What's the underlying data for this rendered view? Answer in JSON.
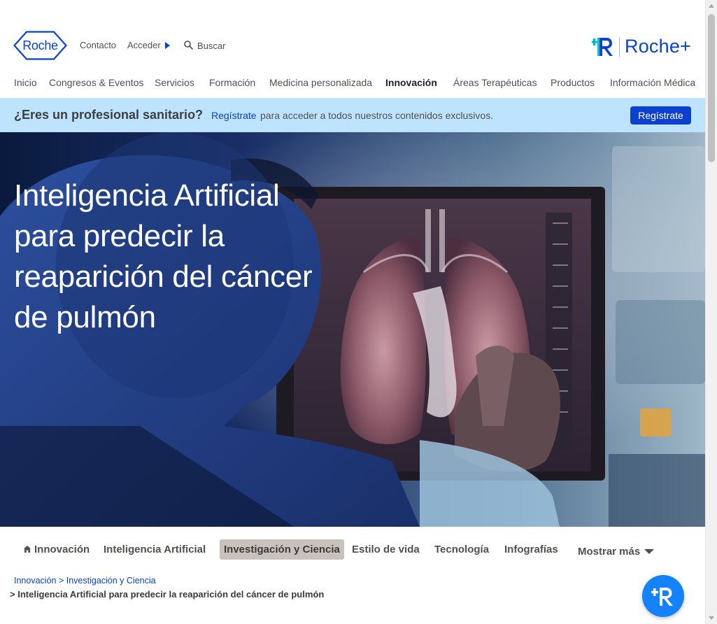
{
  "header": {
    "logo_text": "Roche",
    "top_links": {
      "contacto": "Contacto",
      "acceder": "Acceder",
      "buscar": "Buscar"
    },
    "brand_plus": "Roche+"
  },
  "nav": {
    "items": [
      {
        "label": "Inicio",
        "active": false
      },
      {
        "label": "Congresos & Eventos",
        "active": false
      },
      {
        "label": "Servicios",
        "active": false
      },
      {
        "label": "Formación",
        "active": false
      },
      {
        "label": "Medicina personalizada",
        "active": false
      },
      {
        "label": "Innovación",
        "active": true
      },
      {
        "label": "Áreas Terapéuticas",
        "active": false
      },
      {
        "label": "Productos",
        "active": false
      },
      {
        "label": "Información Médica",
        "active": false
      }
    ]
  },
  "banner": {
    "question": "¿Eres un profesional sanitario?",
    "link": "Regístrate",
    "text": "para acceder a todos nuestros contenidos exclusivos.",
    "button": "Regístrate"
  },
  "hero": {
    "title": "Inteligencia Artificial para predecir la reaparición del cáncer de pulmón"
  },
  "subnav": {
    "items": [
      {
        "label": "Innovación",
        "icon": "home-icon",
        "active": false
      },
      {
        "label": "Inteligencia Artificial",
        "active": false
      },
      {
        "label": "Investigación y Ciencia",
        "active": true
      },
      {
        "label": "Estilo de vida",
        "active": false
      },
      {
        "label": "Tecnología",
        "active": false
      },
      {
        "label": "Infografías",
        "active": false
      }
    ],
    "more": "Mostrar más"
  },
  "breadcrumb": {
    "items": [
      "Innovación",
      "Investigación y Ciencia"
    ],
    "current": "Inteligencia Artificial para predecir la reaparición del cáncer de pulmón"
  },
  "colors": {
    "brand_blue": "#0b41cd",
    "banner_bg": "#bde3ff",
    "fab_blue": "#1482fa",
    "active_tab_bg": "#c9c1bb",
    "text": "#544f4f"
  }
}
